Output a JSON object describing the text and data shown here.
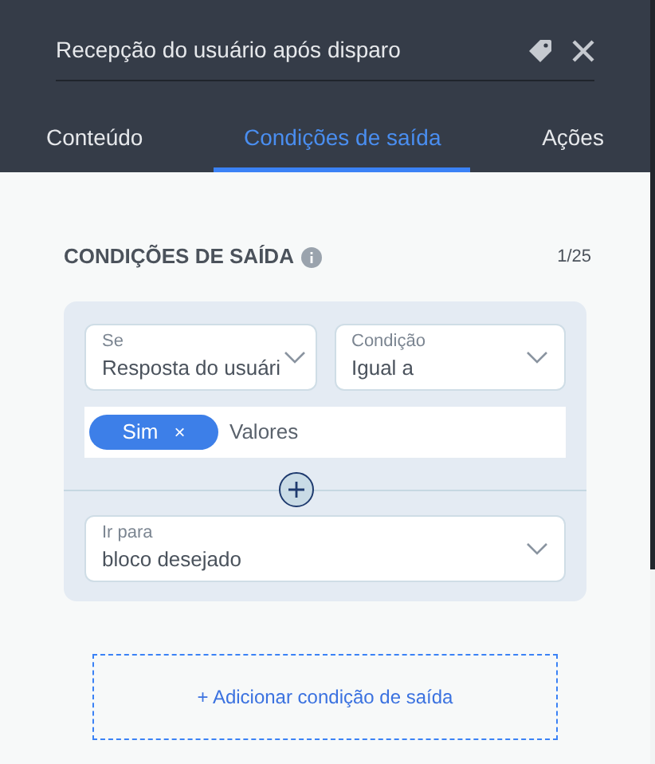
{
  "header": {
    "title": "Recepção do usuário após disparo"
  },
  "tabs": [
    {
      "label": "Conteúdo",
      "selected": false
    },
    {
      "label": "Condições de saída",
      "selected": true
    },
    {
      "label": "Ações",
      "selected": false
    }
  ],
  "section": {
    "title": "CONDIÇÕES DE SAÍDA",
    "count": "1/25"
  },
  "condition": {
    "if_field": {
      "label": "Se",
      "value": "Resposta do usuári"
    },
    "condition_field": {
      "label": "Condição",
      "value": "Igual a"
    },
    "values": {
      "tags": [
        {
          "label": "Sim",
          "remove": "×"
        }
      ],
      "placeholder": "Valores"
    },
    "goto_field": {
      "label": "Ir para",
      "value": "bloco desejado"
    }
  },
  "add_button": "+ Adicionar condição de saída"
}
